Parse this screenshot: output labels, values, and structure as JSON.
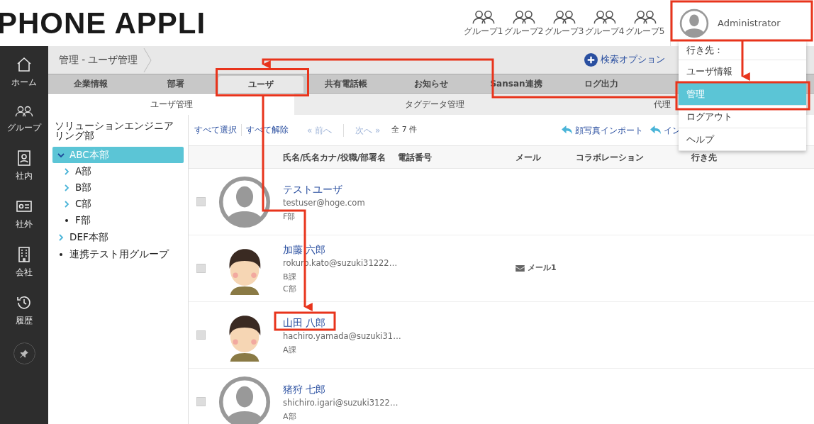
{
  "header": {
    "logo": "PHONE APPLI",
    "groups": [
      {
        "label": "グループ1"
      },
      {
        "label": "グループ2"
      },
      {
        "label": "グループ3"
      },
      {
        "label": "グループ4"
      },
      {
        "label": "グループ5"
      }
    ],
    "user": {
      "name": "Administrator"
    }
  },
  "sidebar": {
    "items": [
      {
        "label": "ホーム"
      },
      {
        "label": "グループ"
      },
      {
        "label": "社内"
      },
      {
        "label": "社外"
      },
      {
        "label": "会社"
      },
      {
        "label": "履歴"
      }
    ]
  },
  "breadcrumb": "管理 - ユーザ管理",
  "search_option": "検索オプション",
  "tabs": [
    {
      "label": "企業情報",
      "selected": false
    },
    {
      "label": "部署",
      "selected": false
    },
    {
      "label": "ユーザ",
      "selected": true
    },
    {
      "label": "共有電話帳",
      "selected": false
    },
    {
      "label": "お知らせ",
      "selected": false
    },
    {
      "label": "Sansan連携",
      "selected": false
    },
    {
      "label": "ログ出力",
      "selected": false
    }
  ],
  "subtabs": [
    {
      "label": "ユーザ管理",
      "selected": true
    },
    {
      "label": "タグデータ管理",
      "selected": false
    },
    {
      "label": "代理",
      "selected": false
    }
  ],
  "tree": {
    "title": "ソリューションエンジニアリング部",
    "items": [
      {
        "label": "ABC本部",
        "kind": "folder",
        "expanded": true,
        "selected": true,
        "children": [
          {
            "label": "A部",
            "kind": "folder",
            "expanded": false,
            "selected": false
          },
          {
            "label": "B部",
            "kind": "folder",
            "expanded": false,
            "selected": false
          },
          {
            "label": "C部",
            "kind": "folder",
            "expanded": false,
            "selected": false
          },
          {
            "label": "F部",
            "kind": "leaf",
            "selected": false
          }
        ]
      },
      {
        "label": "DEF本部",
        "kind": "folder",
        "expanded": false,
        "selected": false
      },
      {
        "label": "連携テスト用グループ",
        "kind": "leaf",
        "selected": false
      }
    ]
  },
  "toolbar": {
    "select_all": "すべて選択",
    "deselect_all": "すべて解除",
    "prev": {
      "arrow": "«",
      "label": "前へ",
      "disabled": true
    },
    "next": {
      "label": "次へ",
      "arrow": "»",
      "disabled": true
    },
    "count": "全 7 件",
    "actions": [
      "顔写真インポート",
      "イン"
    ]
  },
  "table": {
    "columns": [
      "氏名/氏名カナ/役職/部署名",
      "電話番号",
      "メール",
      "コラボレーション",
      "行き先"
    ],
    "rows": [
      {
        "checked": false,
        "has_photo": false,
        "name": "テストユーザ",
        "email": "testuser@hoge.com",
        "lines": [
          "F部"
        ]
      },
      {
        "checked": false,
        "has_photo": true,
        "name": "加藤 六郎",
        "email": "rokuro.kato@suzuki31222…",
        "lines": [
          "B課",
          "C部"
        ],
        "mail": "メール1"
      },
      {
        "checked": false,
        "has_photo": true,
        "name": "山田 八郎",
        "email": "hachiro.yamada@suzuki31…",
        "lines": [
          "A課"
        ]
      },
      {
        "checked": false,
        "has_photo": false,
        "name": "猪狩 七郎",
        "email": "shichiro.igari@suzuki3122…",
        "lines": [
          "A部"
        ]
      }
    ]
  },
  "menu": {
    "title": "行き先：",
    "items": [
      {
        "label": "ユーザ情報",
        "selected": false
      },
      {
        "label": "管理",
        "selected": true
      },
      {
        "label": "ログアウト",
        "selected": false
      },
      {
        "label": "ヘルプ",
        "selected": false
      }
    ]
  }
}
